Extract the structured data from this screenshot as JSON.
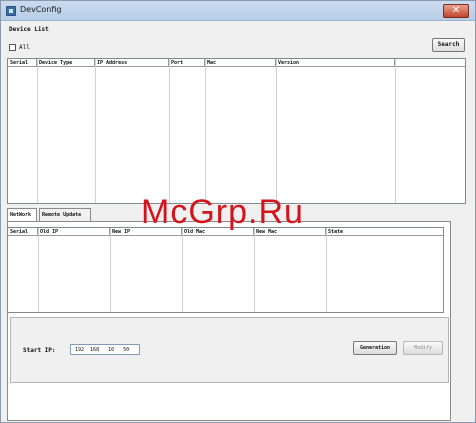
{
  "window": {
    "title": "DevConfig",
    "close_glyph": "✕"
  },
  "device_list": {
    "group_label": "Device List",
    "all_label": "All",
    "search_label": "Search",
    "columns": [
      "Serial",
      "Device Type",
      "IP Address",
      "Port",
      "Mac",
      "Version"
    ]
  },
  "tabs": [
    "NetWork",
    "Remote Update"
  ],
  "network": {
    "columns": [
      "Serial",
      "Old IP",
      "New IP",
      "Old Mac",
      "New Mac",
      "State"
    ],
    "start_ip_label": "Start IP:",
    "start_ip_value": "192  168   10   50",
    "generation_label": "Generation",
    "modify_label": "Modify"
  },
  "watermark": {
    "text": "McGrp.Ru"
  },
  "colors": {
    "watermark": "#d4141c",
    "titlebar": "#c9dbef",
    "close": "#c3442c"
  }
}
